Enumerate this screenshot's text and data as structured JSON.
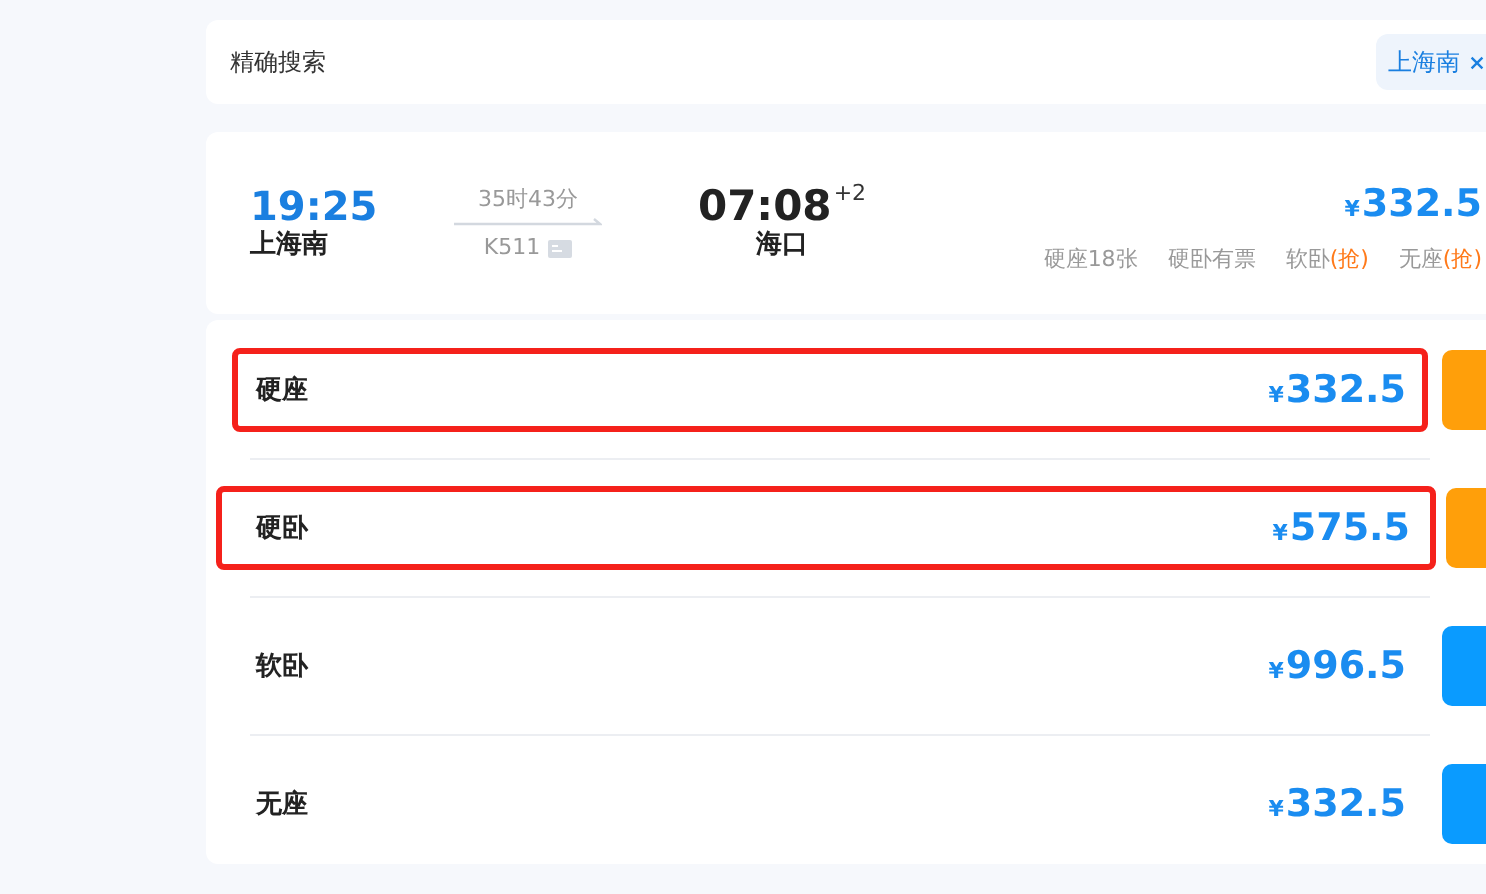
{
  "search_bar": {
    "label": "精确搜索",
    "filter_tag": "上海南"
  },
  "train": {
    "depart_time": "19:25",
    "depart_station": "上海南",
    "duration": "35时43分",
    "number": "K511",
    "arrive_time": "07:08",
    "day_offset": "+2",
    "arrive_station": "海口",
    "currency": "¥",
    "price": "332.5",
    "availability": [
      {
        "text": "硬座18张"
      },
      {
        "text": "硬卧有票"
      },
      {
        "text": "软卧",
        "tag": "(抢)"
      },
      {
        "text": "无座",
        "tag": "(抢)"
      }
    ]
  },
  "seats": [
    {
      "name": "硬座",
      "currency": "¥",
      "price": "332.5",
      "color": "#ff9f0a",
      "highlighted": true
    },
    {
      "name": "硬卧",
      "currency": "¥",
      "price": "575.5",
      "color": "#ff9f0a",
      "highlighted": true
    },
    {
      "name": "软卧",
      "currency": "¥",
      "price": "996.5",
      "color": "#0a9bff",
      "highlighted": false
    },
    {
      "name": "无座",
      "currency": "¥",
      "price": "332.5",
      "color": "#0a9bff",
      "highlighted": false
    }
  ]
}
